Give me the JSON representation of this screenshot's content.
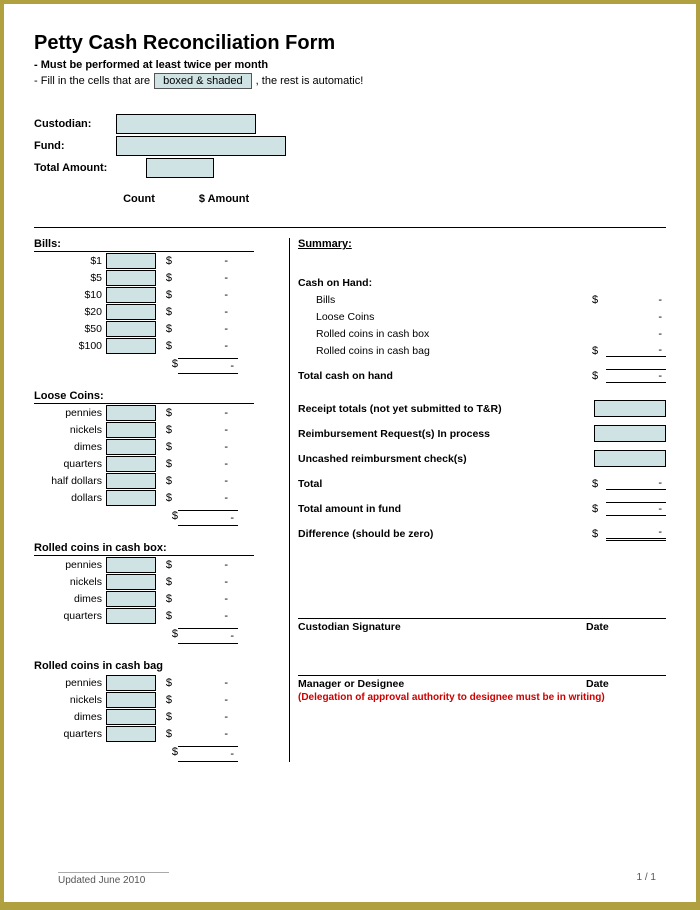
{
  "title": "Petty Cash Reconciliation Form",
  "subtitle_bold": "- Must be performed at least twice per month",
  "instr_prefix": "- Fill in the cells that are",
  "instr_box": "boxed & shaded",
  "instr_suffix": ", the rest is automatic!",
  "fields": {
    "custodian": "Custodian:",
    "fund": "Fund:",
    "total_amount": "Total Amount:"
  },
  "col_count": "Count",
  "col_amount": "$ Amount",
  "bills": {
    "header": "Bills:",
    "rows": [
      "$1",
      "$5",
      "$10",
      "$20",
      "$50",
      "$100"
    ]
  },
  "loose_coins": {
    "header": "Loose Coins:",
    "rows": [
      "pennies",
      "nickels",
      "dimes",
      "quarters",
      "half dollars",
      "dollars"
    ]
  },
  "rolled_box": {
    "header": "Rolled coins in cash box:",
    "rows": [
      "pennies",
      "nickels",
      "dimes",
      "quarters"
    ]
  },
  "rolled_bag": {
    "header": "Rolled coins in cash bag",
    "rows": [
      "pennies",
      "nickels",
      "dimes",
      "quarters"
    ]
  },
  "dollar": "$",
  "dash": "-",
  "summary": {
    "header": "Summary:",
    "cash_on_hand": "Cash on Hand:",
    "bills": "Bills",
    "loose_coins": "Loose Coins",
    "rolled_box": "Rolled coins in cash box",
    "rolled_bag": "Rolled coins in cash bag",
    "total_cash": "Total cash on hand",
    "receipts": "Receipt totals (not yet submitted to T&R)",
    "reimb_req": "Reimbursement Request(s) In process",
    "uncashed": "Uncashed reimbursment check(s)",
    "total": "Total",
    "total_fund": "Total amount in fund",
    "difference": "Difference (should be zero)",
    "custodian_sig": "Custodian Signature",
    "date": "Date",
    "manager_sig": "Manager or Designee",
    "delegation": "(Delegation of approval authority to designee must be in writing)"
  },
  "footer_left": "Updated June 2010",
  "footer_right": "1 / 1"
}
